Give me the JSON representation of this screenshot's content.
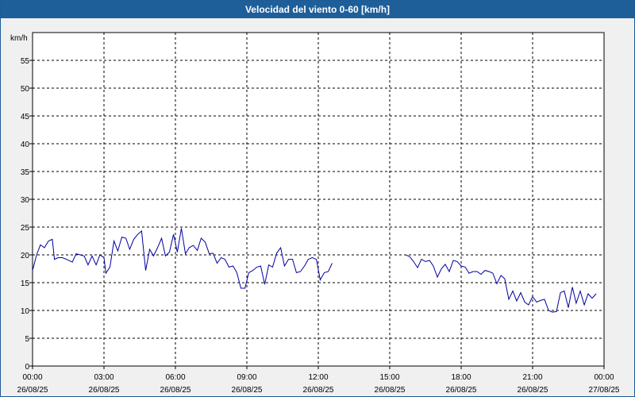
{
  "chart_data": {
    "type": "line",
    "title": "Velocidad del viento 0-60 [km/h]",
    "ylabel": "km/h",
    "ylim": [
      0,
      60
    ],
    "yticks": [
      0,
      5,
      10,
      15,
      20,
      25,
      30,
      35,
      40,
      45,
      50,
      55
    ],
    "xlim_hours": [
      0,
      24
    ],
    "xticks": [
      {
        "time": "00:00",
        "date": "26/08/25"
      },
      {
        "time": "03:00",
        "date": "26/08/25"
      },
      {
        "time": "06:00",
        "date": "26/08/25"
      },
      {
        "time": "09:00",
        "date": "26/08/25"
      },
      {
        "time": "12:00",
        "date": "26/08/25"
      },
      {
        "time": "15:00",
        "date": "26/08/25"
      },
      {
        "time": "18:00",
        "date": "26/08/25"
      },
      {
        "time": "21:00",
        "date": "26/08/25"
      },
      {
        "time": "00:00",
        "date": "27/08/25"
      }
    ],
    "grid": true,
    "line_color": "#0000a0",
    "series": [
      {
        "segments": [
          [
            [
              0.0,
              17.2
            ],
            [
              0.17,
              20.0
            ],
            [
              0.33,
              21.8
            ],
            [
              0.5,
              21.3
            ],
            [
              0.67,
              22.5
            ],
            [
              0.83,
              22.8
            ],
            [
              0.92,
              19.2
            ],
            [
              1.08,
              19.5
            ],
            [
              1.25,
              19.5
            ],
            [
              1.42,
              19.2
            ],
            [
              1.67,
              18.7
            ],
            [
              1.83,
              20.2
            ],
            [
              2.0,
              20.0
            ],
            [
              2.17,
              19.8
            ],
            [
              2.33,
              18.2
            ],
            [
              2.5,
              19.8
            ],
            [
              2.67,
              18.2
            ],
            [
              2.83,
              20.0
            ],
            [
              3.0,
              19.5
            ],
            [
              3.08,
              16.7
            ],
            [
              3.25,
              17.8
            ],
            [
              3.42,
              22.5
            ],
            [
              3.58,
              20.7
            ],
            [
              3.75,
              23.2
            ],
            [
              3.92,
              23.0
            ],
            [
              4.08,
              21.0
            ],
            [
              4.25,
              22.8
            ],
            [
              4.42,
              23.7
            ],
            [
              4.58,
              24.3
            ],
            [
              4.75,
              17.2
            ],
            [
              4.92,
              21.0
            ],
            [
              5.08,
              19.8
            ],
            [
              5.25,
              21.3
            ],
            [
              5.42,
              23.0
            ],
            [
              5.58,
              19.8
            ],
            [
              5.75,
              20.5
            ],
            [
              5.92,
              23.7
            ],
            [
              6.08,
              20.5
            ],
            [
              6.25,
              24.8
            ],
            [
              6.42,
              20.2
            ],
            [
              6.58,
              21.3
            ],
            [
              6.75,
              21.7
            ],
            [
              6.92,
              20.8
            ],
            [
              7.08,
              23.0
            ],
            [
              7.25,
              22.3
            ],
            [
              7.42,
              20.2
            ],
            [
              7.58,
              20.3
            ],
            [
              7.75,
              18.5
            ],
            [
              7.92,
              19.5
            ],
            [
              8.08,
              19.2
            ],
            [
              8.25,
              17.8
            ],
            [
              8.42,
              18.0
            ],
            [
              8.58,
              16.8
            ],
            [
              8.75,
              14.0
            ],
            [
              8.92,
              14.0
            ],
            [
              9.08,
              16.8
            ],
            [
              9.25,
              17.2
            ],
            [
              9.42,
              17.8
            ],
            [
              9.58,
              18.0
            ],
            [
              9.75,
              14.7
            ],
            [
              9.92,
              18.2
            ],
            [
              10.08,
              17.8
            ],
            [
              10.25,
              20.3
            ],
            [
              10.42,
              21.3
            ],
            [
              10.58,
              18.0
            ],
            [
              10.75,
              19.2
            ],
            [
              10.92,
              19.2
            ],
            [
              11.08,
              16.8
            ],
            [
              11.25,
              17.0
            ],
            [
              11.42,
              18.0
            ],
            [
              11.58,
              19.2
            ],
            [
              11.75,
              19.5
            ],
            [
              11.92,
              19.2
            ],
            [
              12.08,
              15.5
            ],
            [
              12.25,
              16.8
            ],
            [
              12.42,
              17.0
            ],
            [
              12.58,
              18.5
            ]
          ],
          [
            [
              15.67,
              20.0
            ],
            [
              15.83,
              19.7
            ],
            [
              16.0,
              18.8
            ],
            [
              16.17,
              17.7
            ],
            [
              16.33,
              19.2
            ],
            [
              16.5,
              18.8
            ],
            [
              16.67,
              19.0
            ],
            [
              16.83,
              18.0
            ],
            [
              17.0,
              16.0
            ],
            [
              17.17,
              17.5
            ],
            [
              17.33,
              18.3
            ],
            [
              17.5,
              17.0
            ],
            [
              17.67,
              19.0
            ],
            [
              17.83,
              18.8
            ],
            [
              18.0,
              18.0
            ],
            [
              18.17,
              17.8
            ],
            [
              18.33,
              16.7
            ],
            [
              18.5,
              17.0
            ],
            [
              18.67,
              17.0
            ],
            [
              18.83,
              16.5
            ],
            [
              19.0,
              17.2
            ],
            [
              19.17,
              17.0
            ],
            [
              19.33,
              16.7
            ],
            [
              19.5,
              14.8
            ],
            [
              19.67,
              16.3
            ],
            [
              19.83,
              15.7
            ],
            [
              20.0,
              12.0
            ],
            [
              20.17,
              13.5
            ],
            [
              20.33,
              11.7
            ],
            [
              20.5,
              13.2
            ],
            [
              20.67,
              11.5
            ],
            [
              20.83,
              11.0
            ],
            [
              21.0,
              12.5
            ],
            [
              21.17,
              11.5
            ],
            [
              21.33,
              11.8
            ],
            [
              21.5,
              12.0
            ],
            [
              21.67,
              10.0
            ],
            [
              21.83,
              9.7
            ],
            [
              22.0,
              9.8
            ],
            [
              22.17,
              13.2
            ],
            [
              22.33,
              13.5
            ],
            [
              22.5,
              10.5
            ],
            [
              22.67,
              14.2
            ],
            [
              22.83,
              11.3
            ],
            [
              23.0,
              13.5
            ],
            [
              23.17,
              11.0
            ],
            [
              23.33,
              13.0
            ],
            [
              23.5,
              12.2
            ],
            [
              23.67,
              13.0
            ]
          ]
        ]
      }
    ]
  }
}
